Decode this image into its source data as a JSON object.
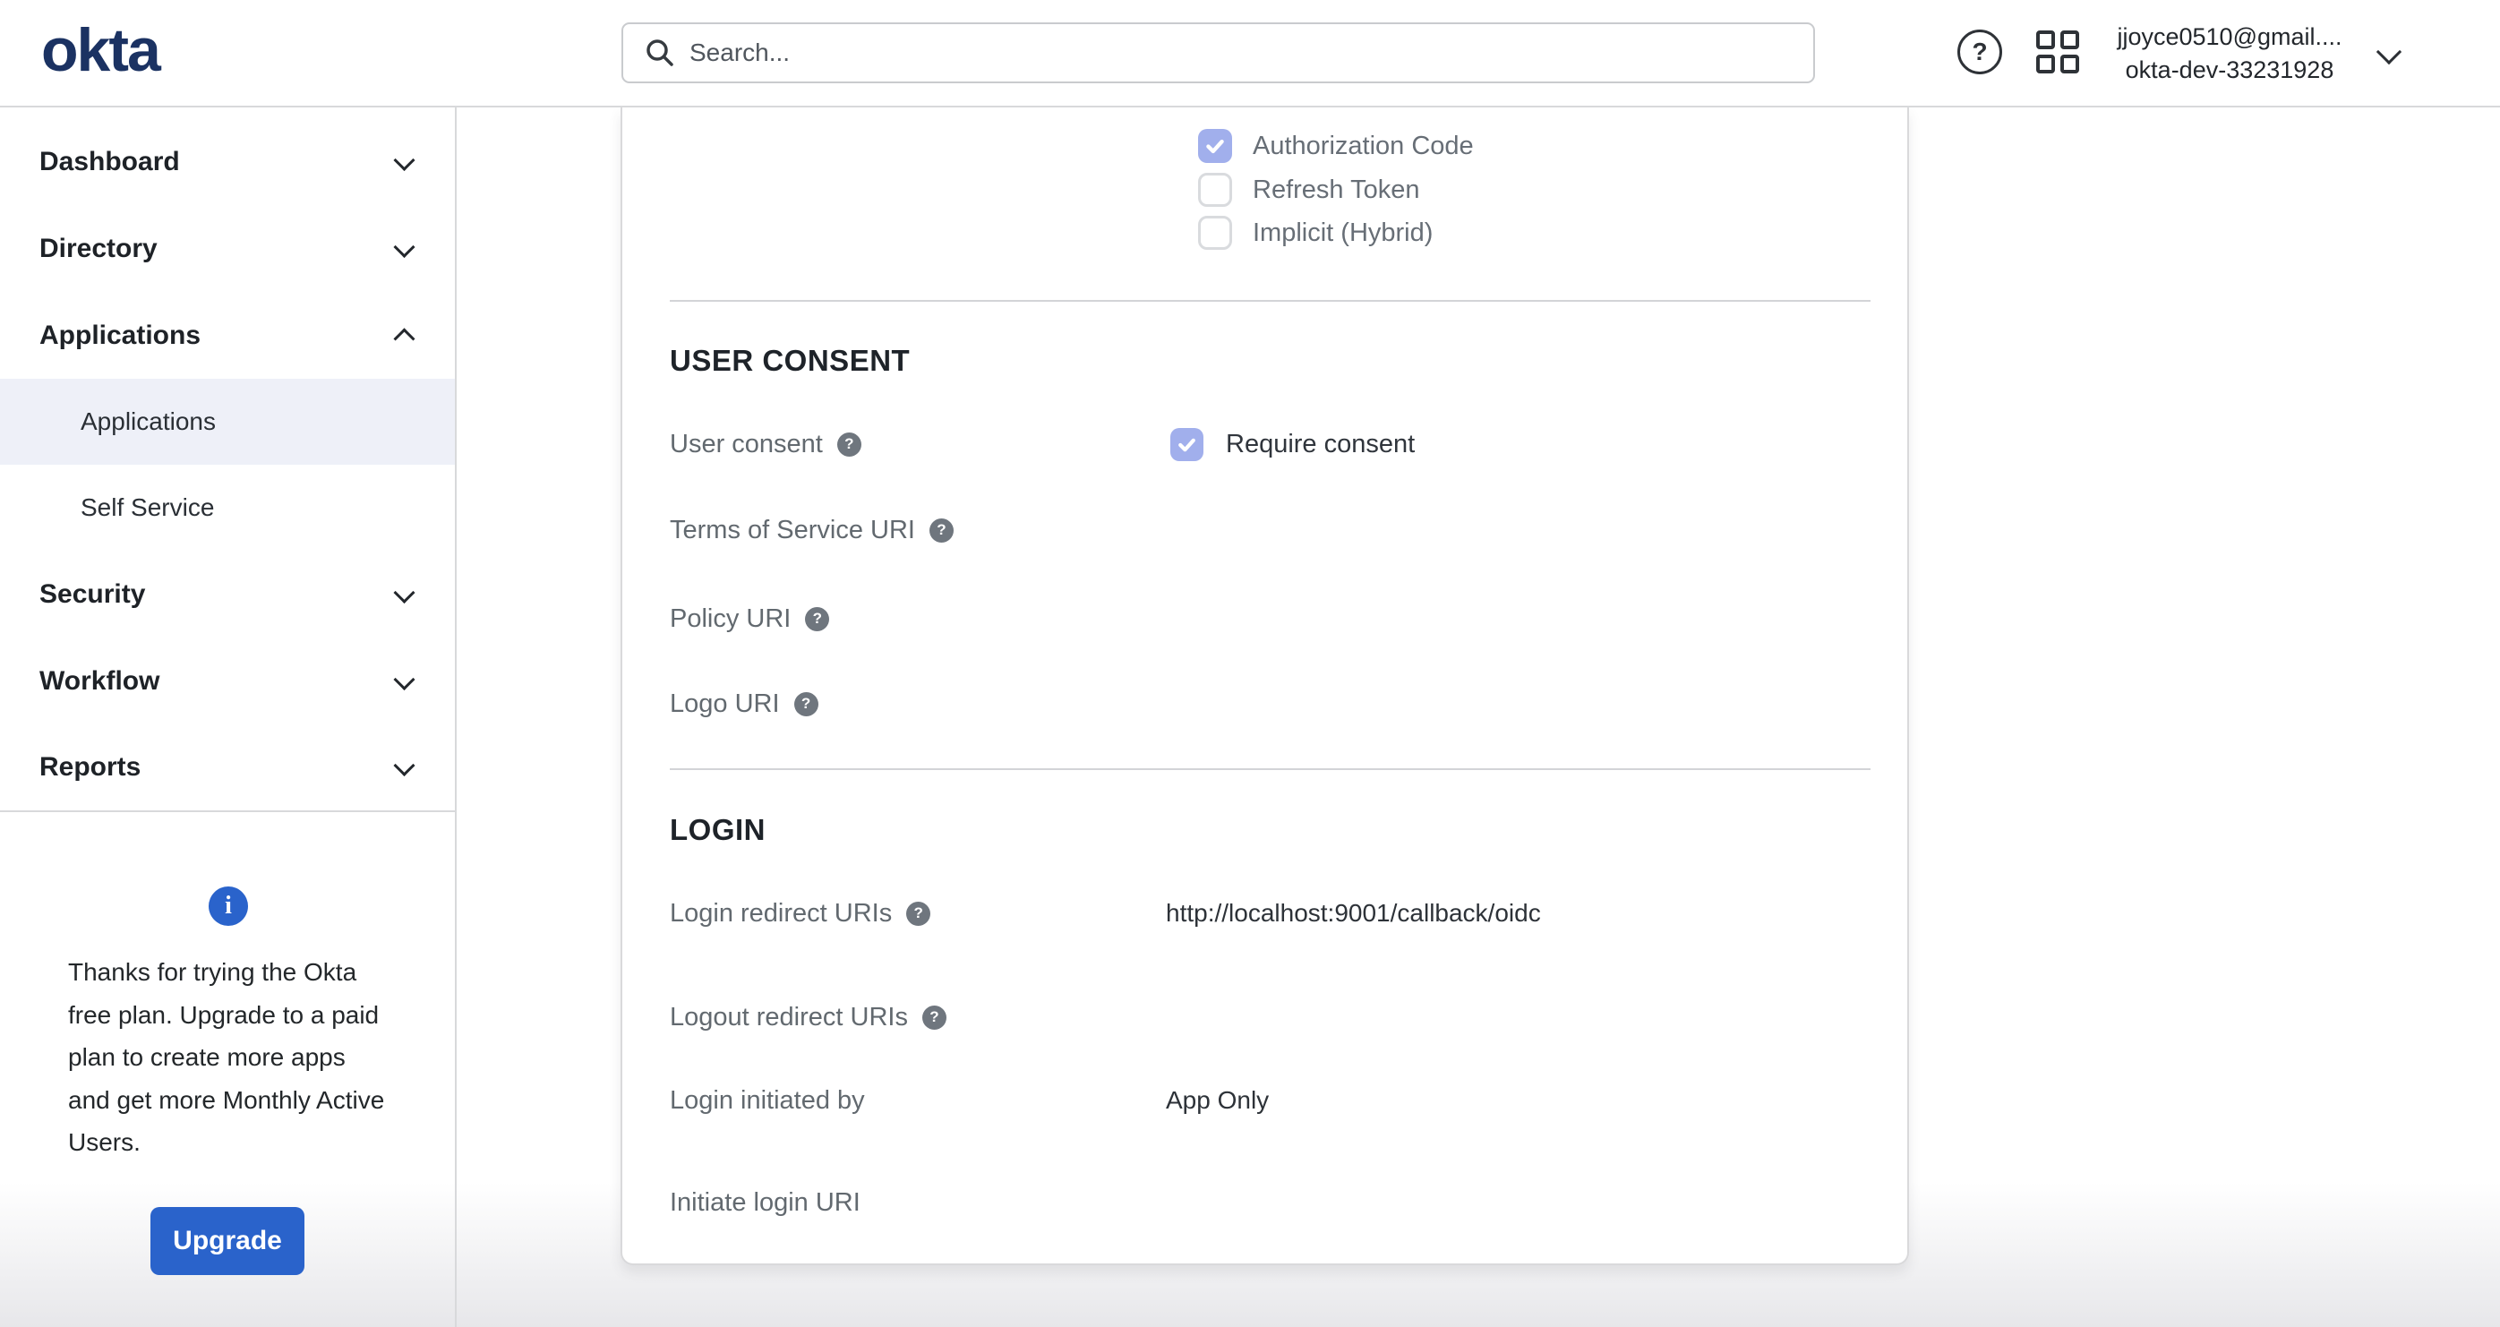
{
  "header": {
    "logo_text": "okta",
    "search_placeholder": "Search...",
    "help_glyph": "?",
    "account": {
      "line1": "jjoyce0510@gmail....",
      "line2": "okta-dev-33231928"
    }
  },
  "sidebar": {
    "items": [
      {
        "label": "Dashboard",
        "state": "collapsed"
      },
      {
        "label": "Directory",
        "state": "collapsed"
      },
      {
        "label": "Applications",
        "state": "expanded"
      },
      {
        "label": "Security",
        "state": "collapsed"
      },
      {
        "label": "Workflow",
        "state": "collapsed"
      },
      {
        "label": "Reports",
        "state": "collapsed"
      }
    ],
    "applications_children": [
      {
        "label": "Applications",
        "selected": true
      },
      {
        "label": "Self Service",
        "selected": false
      }
    ],
    "upgrade": {
      "info_glyph": "i",
      "message": "Thanks for trying the Okta free plan. Upgrade to a paid plan to create more apps and get more Monthly Active Users.",
      "button_label": "Upgrade"
    }
  },
  "main": {
    "grant_types": [
      {
        "label": "Authorization Code",
        "checked": true
      },
      {
        "label": "Refresh Token",
        "checked": false
      },
      {
        "label": "Implicit (Hybrid)",
        "checked": false
      }
    ],
    "user_consent": {
      "title": "USER CONSENT",
      "user_consent_label": "User consent",
      "require_consent": {
        "label": "Require consent",
        "checked": true
      },
      "terms_of_service_label": "Terms of Service URI",
      "policy_label": "Policy URI",
      "logo_label": "Logo URI"
    },
    "login": {
      "title": "LOGIN",
      "login_redirect_label": "Login redirect URIs",
      "login_redirect_value": "http://localhost:9001/callback/oidc",
      "logout_redirect_label": "Logout redirect URIs",
      "login_initiated_label": "Login initiated by",
      "login_initiated_value": "App Only",
      "initiate_login_label": "Initiate login URI"
    }
  },
  "colors": {
    "brand_navy": "#1b3262",
    "primary_blue": "#2a63cb",
    "checkbox_checked": "#a1afec",
    "selected_nav_bg": "#eef0f8",
    "border_gray": "#d8d9db"
  }
}
